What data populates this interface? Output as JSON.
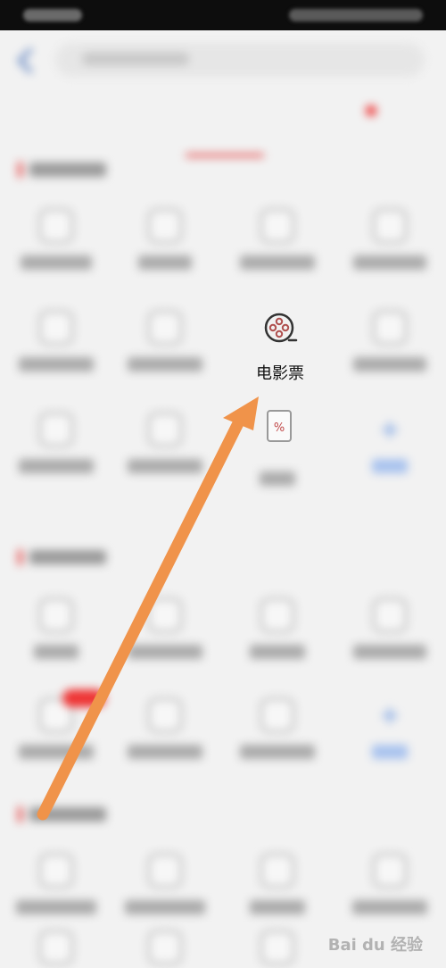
{
  "movie": {
    "label": "电影票"
  },
  "discount": {
    "icon": "percent-icon"
  },
  "colors": {
    "accent": "#e34b4b",
    "arrow": "#f0934a"
  },
  "watermark": "Bai du 经验"
}
